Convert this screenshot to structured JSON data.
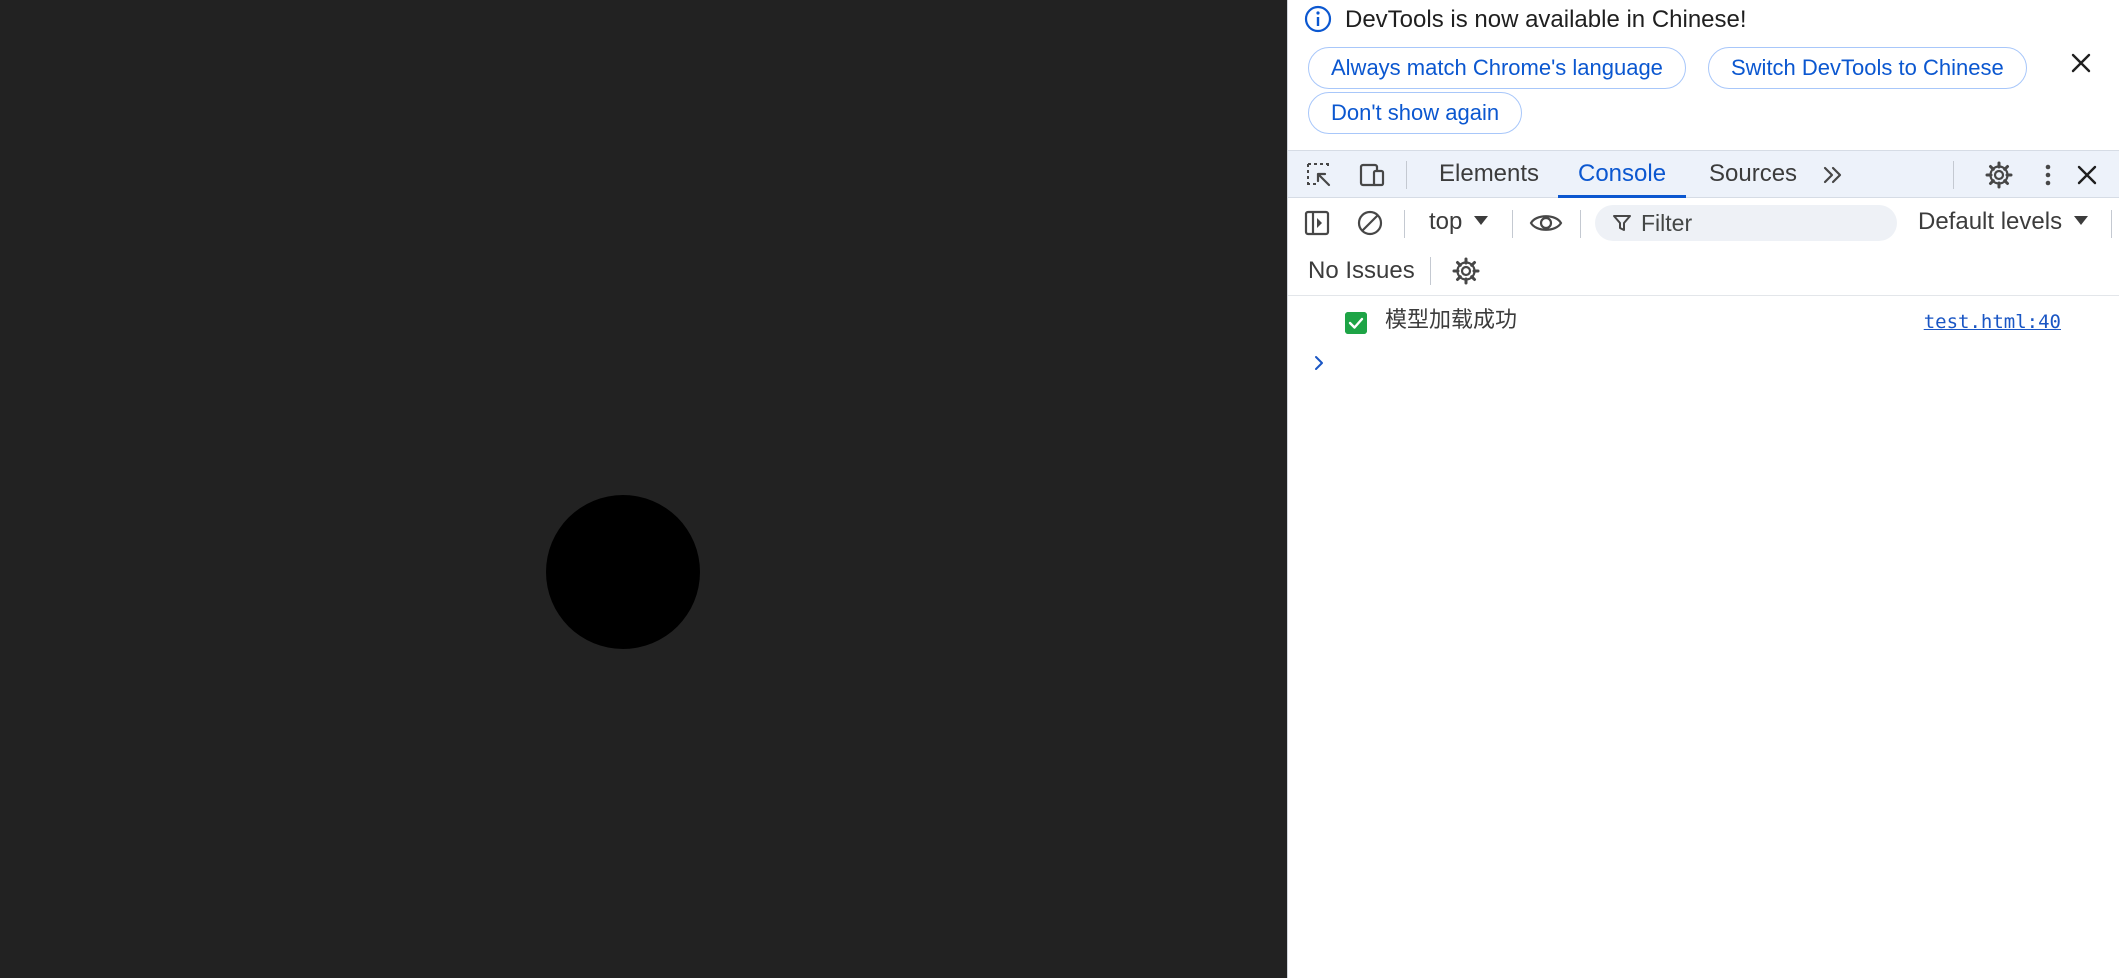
{
  "page": {
    "background_color": "#222222",
    "ball_color": "#000000"
  },
  "devtools": {
    "infobar": {
      "icon": "info-icon",
      "message": "DevTools is now available in Chinese!",
      "buttons": {
        "always_match": "Always match Chrome's language",
        "switch_chinese": "Switch DevTools to Chinese",
        "dont_show": "Don't show again"
      },
      "close_icon": "close-icon"
    },
    "toolbar": {
      "icons": [
        "inspect-element-icon",
        "device-toolbar-icon",
        "more-tabs-icon",
        "settings-icon",
        "kebab-menu-icon",
        "close-icon"
      ],
      "tabs": {
        "elements": "Elements",
        "console": "Console",
        "sources": "Sources"
      },
      "active_tab": "Console",
      "accent_color": "#0b57d0"
    },
    "console_toolbar": {
      "icons": [
        "sidebar-toggle-icon",
        "clear-console-icon",
        "eye-icon",
        "filter-icon"
      ],
      "context": "top",
      "filter_placeholder": "Filter",
      "levels": "Default levels"
    },
    "issues": {
      "label": "No Issues",
      "icon": "gear-icon"
    },
    "messages": [
      {
        "icon": "check-icon",
        "icon_color": "#1ea446",
        "text": "模型加载成功",
        "source": "test.html:40"
      }
    ],
    "prompt_icon": "chevron-right-icon"
  }
}
